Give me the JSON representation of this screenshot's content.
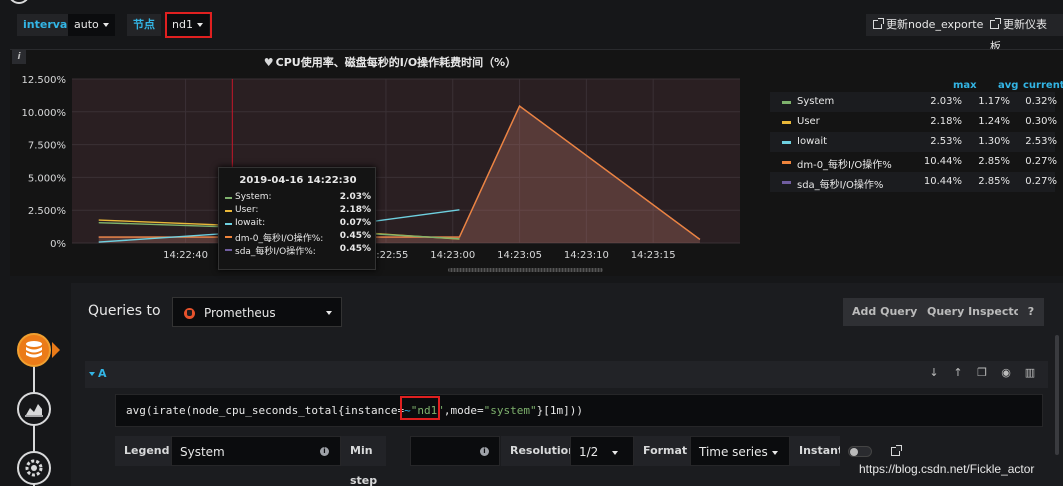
{
  "variables": {
    "interval_label": "interval",
    "interval_value": "auto",
    "node_label": "节点",
    "node_value": "nd1"
  },
  "links": {
    "update_node_exporter": "更新node_exporter",
    "update_dashboard": "更新仪表板"
  },
  "panel": {
    "info_glyph": "i",
    "title": "CPU使用率、磁盘每秒的I/O操作耗费时间（%）"
  },
  "legend": {
    "headers": {
      "max": "max",
      "avg": "avg",
      "current": "current"
    },
    "rows": [
      {
        "name": "System",
        "max": "2.03%",
        "avg": "1.17%",
        "current": "0.32%",
        "color": "#7eb26d"
      },
      {
        "name": "User",
        "max": "2.18%",
        "avg": "1.24%",
        "current": "0.30%",
        "color": "#eab839"
      },
      {
        "name": "Iowait",
        "max": "2.53%",
        "avg": "1.30%",
        "current": "2.53%",
        "color": "#6ed0e0"
      },
      {
        "name": "dm-0_每秒I/O操作%",
        "max": "10.44%",
        "avg": "2.85%",
        "current": "0.27%",
        "color": "#ef843c"
      },
      {
        "name": "sda_每秒I/O操作%",
        "max": "10.44%",
        "avg": "2.85%",
        "current": "0.27%",
        "color": "#705da0"
      }
    ]
  },
  "tooltip": {
    "time": "2019-04-16 14:22:30",
    "rows": [
      {
        "name": "System:",
        "value": "2.03%",
        "color": "#7eb26d"
      },
      {
        "name": "User:",
        "value": "2.18%",
        "color": "#eab839"
      },
      {
        "name": "Iowait:",
        "value": "0.07%",
        "color": "#6ed0e0"
      },
      {
        "name": "dm-0_每秒I/O操作%:",
        "value": "0.45%",
        "color": "#ef843c"
      },
      {
        "name": "sda_每秒I/O操作%:",
        "value": "0.45%",
        "color": "#705da0"
      }
    ]
  },
  "chart_data": {
    "type": "line",
    "y_ticks": [
      "12.500%",
      "10.000%",
      "7.500%",
      "5.000%",
      "2.500%",
      "0%"
    ],
    "x_ticks": [
      "14:22:40",
      "14:22:55",
      "14:23:00",
      "14:23:05",
      "14:23:10",
      "14:23:15"
    ],
    "ylim": [
      0,
      12.5
    ],
    "series": [
      {
        "name": "sda_每秒I/O操作%",
        "color": "#705da0",
        "points": [
          [
            0,
            0.45
          ],
          [
            30,
            0.45
          ],
          [
            35,
            10.44
          ],
          [
            50,
            0.27
          ]
        ]
      },
      {
        "name": "dm-0_每秒I/O操作%",
        "color": "#ef843c",
        "points": [
          [
            0,
            0.45
          ],
          [
            30,
            0.45
          ],
          [
            35,
            10.44
          ],
          [
            50,
            0.27
          ]
        ]
      },
      {
        "name": "Iowait",
        "color": "#6ed0e0",
        "points": [
          [
            0,
            0.07
          ],
          [
            20,
            1.3
          ],
          [
            30,
            2.53
          ]
        ]
      },
      {
        "name": "User",
        "color": "#eab839",
        "points": [
          [
            0,
            1.75
          ],
          [
            15,
            1.2
          ],
          [
            30,
            0.3
          ]
        ]
      },
      {
        "name": "System",
        "color": "#7eb26d",
        "points": [
          [
            0,
            1.55
          ],
          [
            15,
            1.1
          ],
          [
            30,
            0.32
          ]
        ]
      }
    ],
    "grid": true,
    "hover_marker": "14:22:30"
  },
  "editor": {
    "queries_to": "Queries to",
    "datasource": "Prometheus",
    "add_query": "Add Query",
    "query_inspector": "Query Inspector",
    "help": "?",
    "ref_id": "A",
    "query_prefix": "avg(irate(node_cpu_seconds_total{instance=",
    "query_op": "~",
    "query_str1": "\"nd1\"",
    "query_mid": ",mode=",
    "query_str2": "\"system\"",
    "query_suffix": "}[1m]))",
    "legend_label": "Legend",
    "legend_value": "System",
    "min_step_label": "Min step",
    "resolution_label": "Resolution",
    "resolution_value": "1/2",
    "format_label": "Format",
    "format_value": "Time series",
    "instant_label": "Instant"
  },
  "watermark": "https://blog.csdn.net/Fickle_actor"
}
